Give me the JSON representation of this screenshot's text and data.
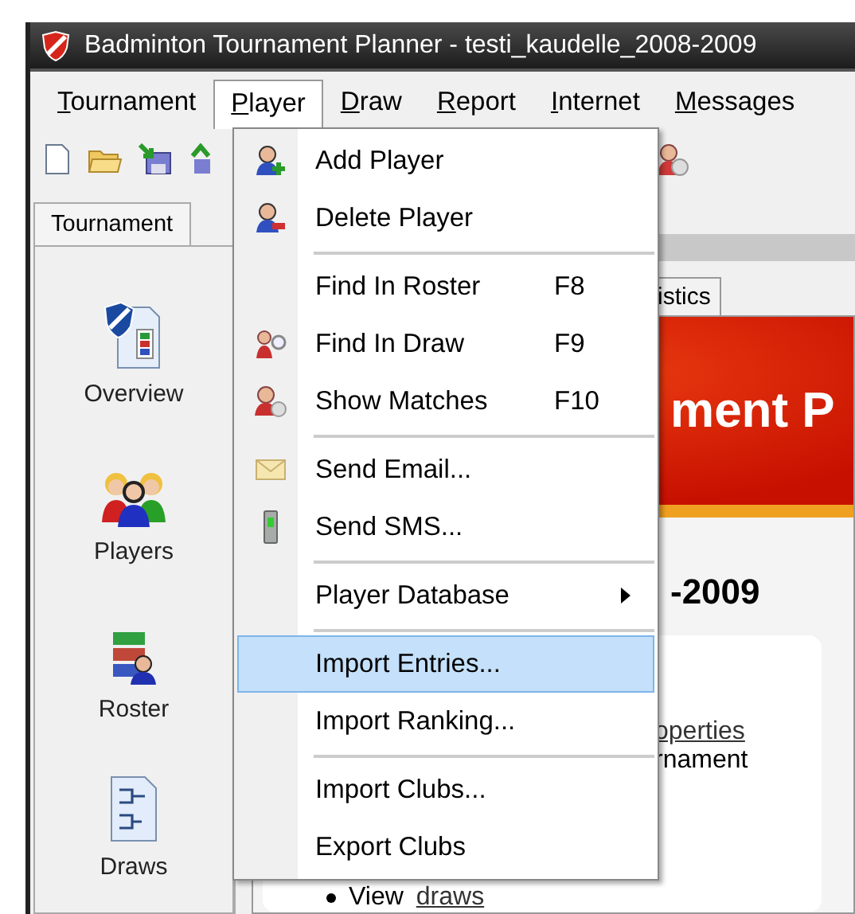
{
  "window": {
    "title": "Badminton Tournament Planner - testi_kaudelle_2008-2009"
  },
  "menubar": [
    {
      "label": "Tournament",
      "selected": false
    },
    {
      "label": "Player",
      "selected": true
    },
    {
      "label": "Draw",
      "selected": false
    },
    {
      "label": "Report",
      "selected": false
    },
    {
      "label": "Internet",
      "selected": false
    },
    {
      "label": "Messages",
      "selected": false
    }
  ],
  "sidebar": {
    "tab": "Tournament",
    "items": [
      {
        "label": "Overview"
      },
      {
        "label": "Players"
      },
      {
        "label": "Roster"
      },
      {
        "label": "Draws"
      }
    ]
  },
  "content": {
    "tab": "istics",
    "banner": "ment P",
    "heading": "-2009",
    "link_1": "operties",
    "text_1": "rnament",
    "bullet_text": "View",
    "bullet_link": "draws"
  },
  "player_menu": [
    {
      "kind": "item",
      "label": "Add Player",
      "selected": false
    },
    {
      "kind": "item",
      "label": "Delete Player",
      "selected": false
    },
    {
      "kind": "separator"
    },
    {
      "kind": "item",
      "label": "Find In Roster",
      "shortcut": "F8",
      "selected": false
    },
    {
      "kind": "item",
      "label": "Find In Draw",
      "shortcut": "F9",
      "selected": false
    },
    {
      "kind": "item",
      "label": "Show Matches",
      "shortcut": "F10",
      "selected": false
    },
    {
      "kind": "separator"
    },
    {
      "kind": "item",
      "label": "Send Email...",
      "selected": false
    },
    {
      "kind": "item",
      "label": "Send SMS...",
      "selected": false
    },
    {
      "kind": "separator"
    },
    {
      "kind": "submenu",
      "label": "Player Database",
      "selected": false
    },
    {
      "kind": "separator"
    },
    {
      "kind": "item",
      "label": "Import Entries...",
      "selected": true
    },
    {
      "kind": "item",
      "label": "Import Ranking...",
      "selected": false
    },
    {
      "kind": "separator"
    },
    {
      "kind": "item",
      "label": "Import Clubs...",
      "selected": false
    },
    {
      "kind": "item",
      "label": "Export Clubs",
      "selected": false
    }
  ]
}
